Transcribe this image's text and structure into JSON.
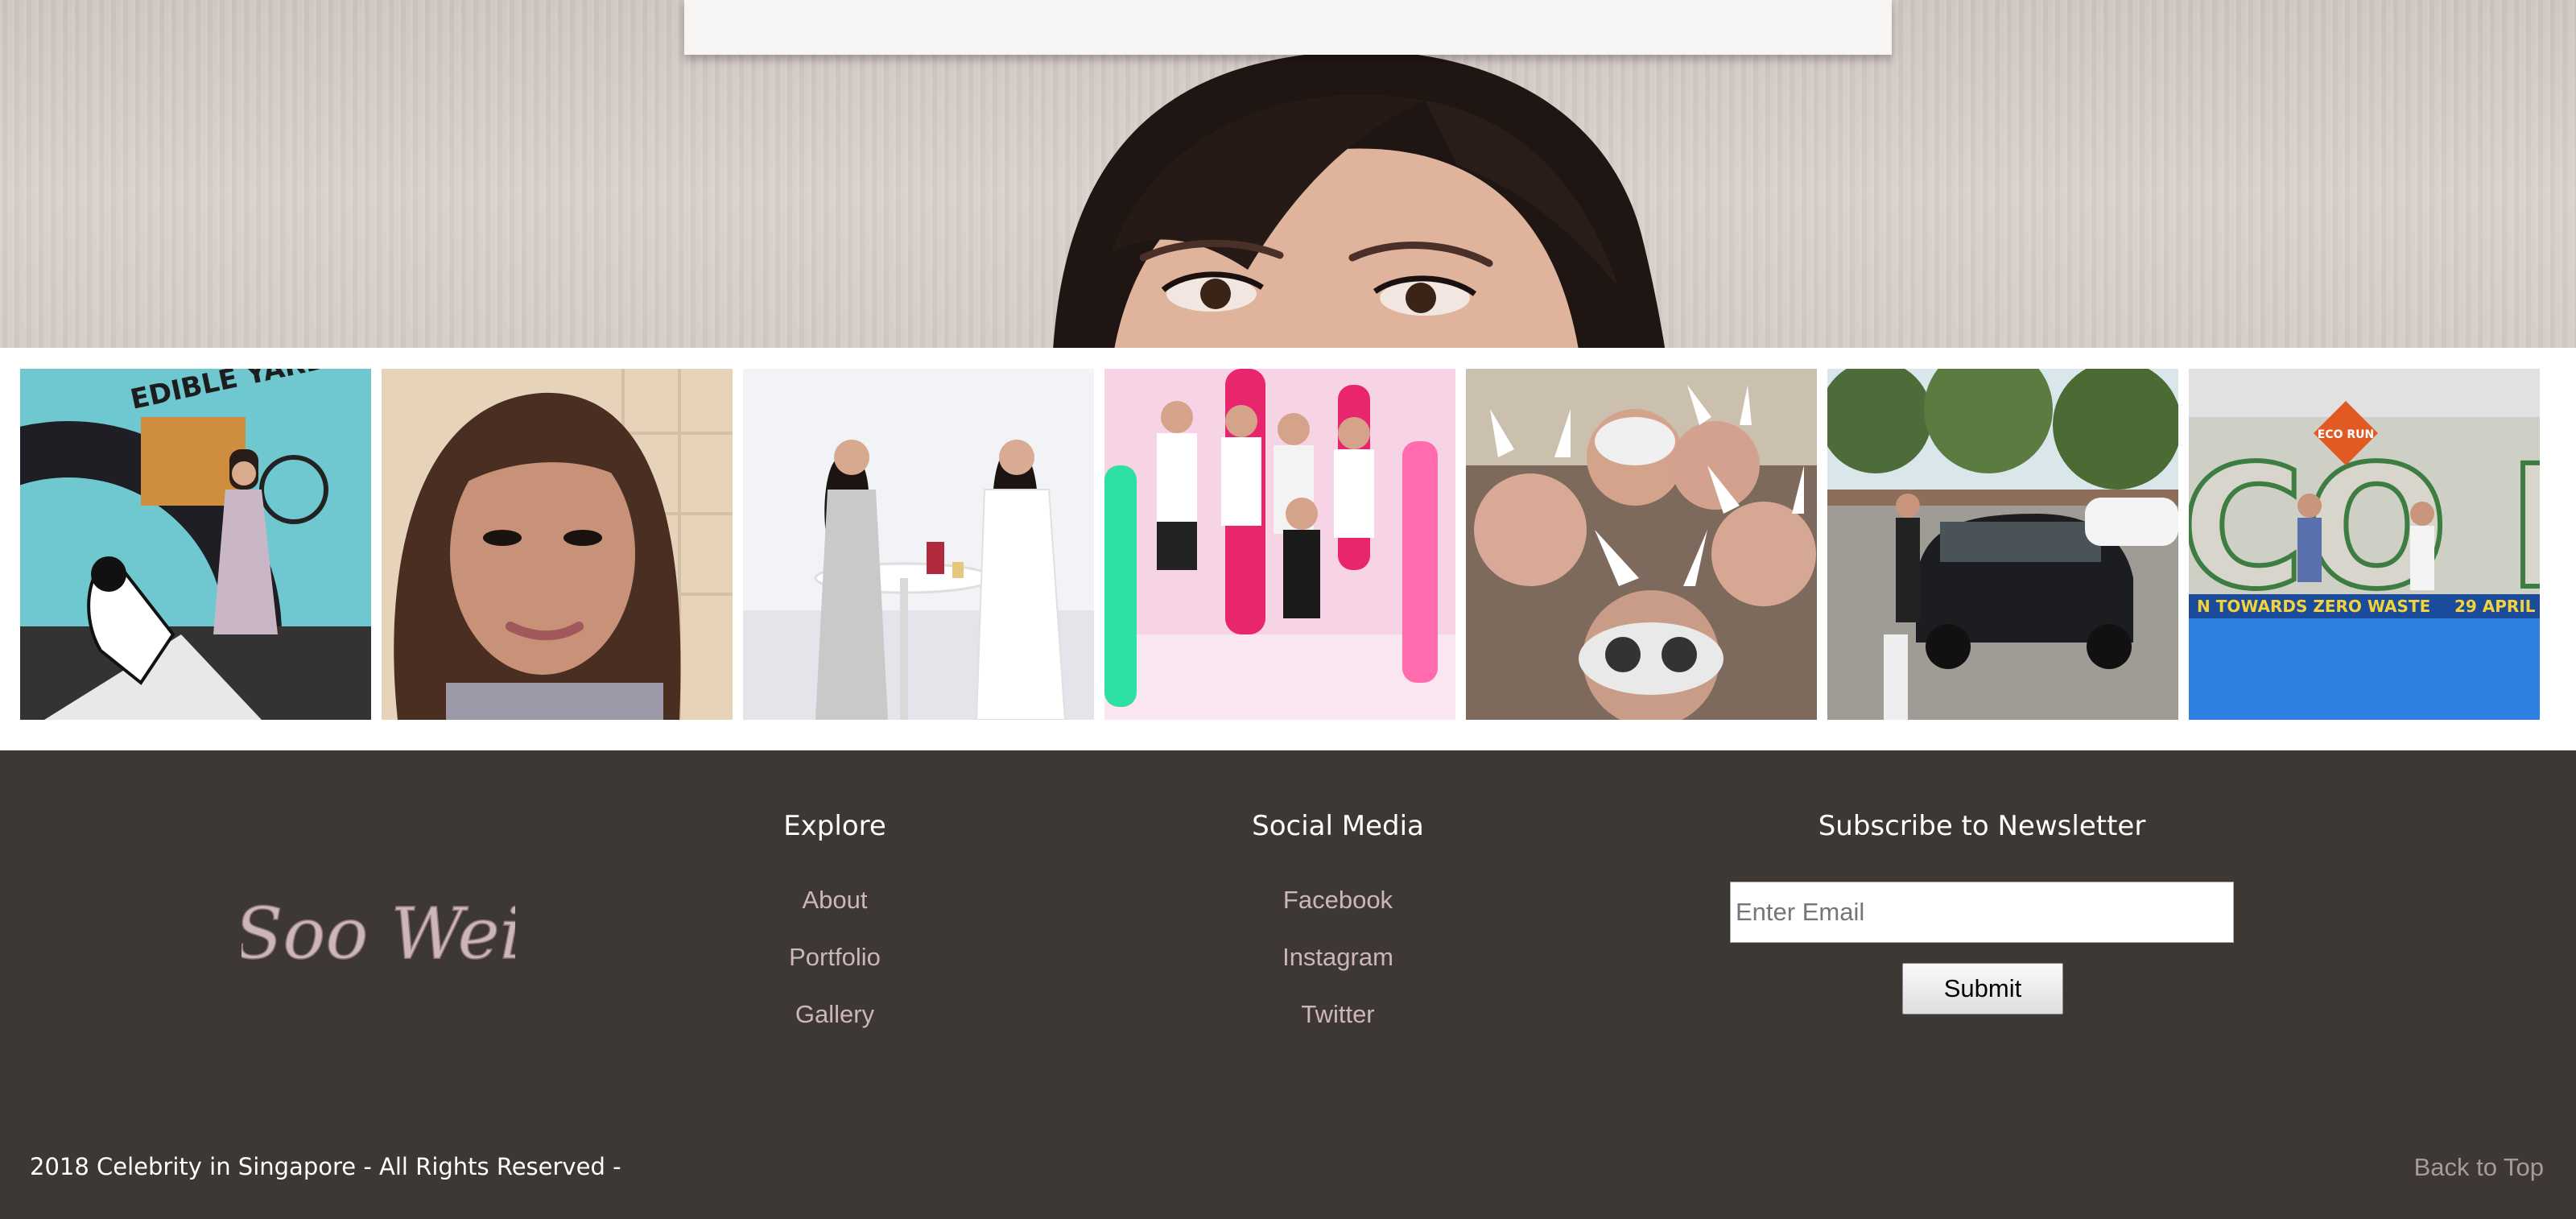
{
  "gallery": {
    "photos": [
      {
        "icon": "edible-yard-mural-photo"
      },
      {
        "icon": "selfie-portrait-photo"
      },
      {
        "icon": "cafe-conversation-photo"
      },
      {
        "icon": "pink-cactus-group-photo"
      },
      {
        "icon": "bunny-filter-group-selfie-photo"
      },
      {
        "icon": "car-park-photo"
      },
      {
        "icon": "eco-run-event-photo"
      }
    ],
    "mural_text": "EDIBLE YARD",
    "event_text": "ECO RUN",
    "event_banner": "N TOWARDS ZERO WASTE",
    "event_date": "29 APRIL"
  },
  "footer": {
    "logo_text": "Soo Wei",
    "explore": {
      "title": "Explore",
      "links": [
        "About",
        "Portfolio",
        "Gallery"
      ]
    },
    "social": {
      "title": "Social Media",
      "links": [
        "Facebook",
        "Instagram",
        "Twitter"
      ]
    },
    "newsletter": {
      "title": "Subscribe to Newsletter",
      "email_placeholder": "Enter Email",
      "submit_label": "Submit"
    },
    "copyright": "2018 Celebrity in Singapore - All Rights Reserved -",
    "back_to_top": "Back to Top"
  },
  "colors": {
    "footer_bg": "#3e3835",
    "link_color": "#cdb6b8",
    "logo_color": "#cdb6b8"
  }
}
